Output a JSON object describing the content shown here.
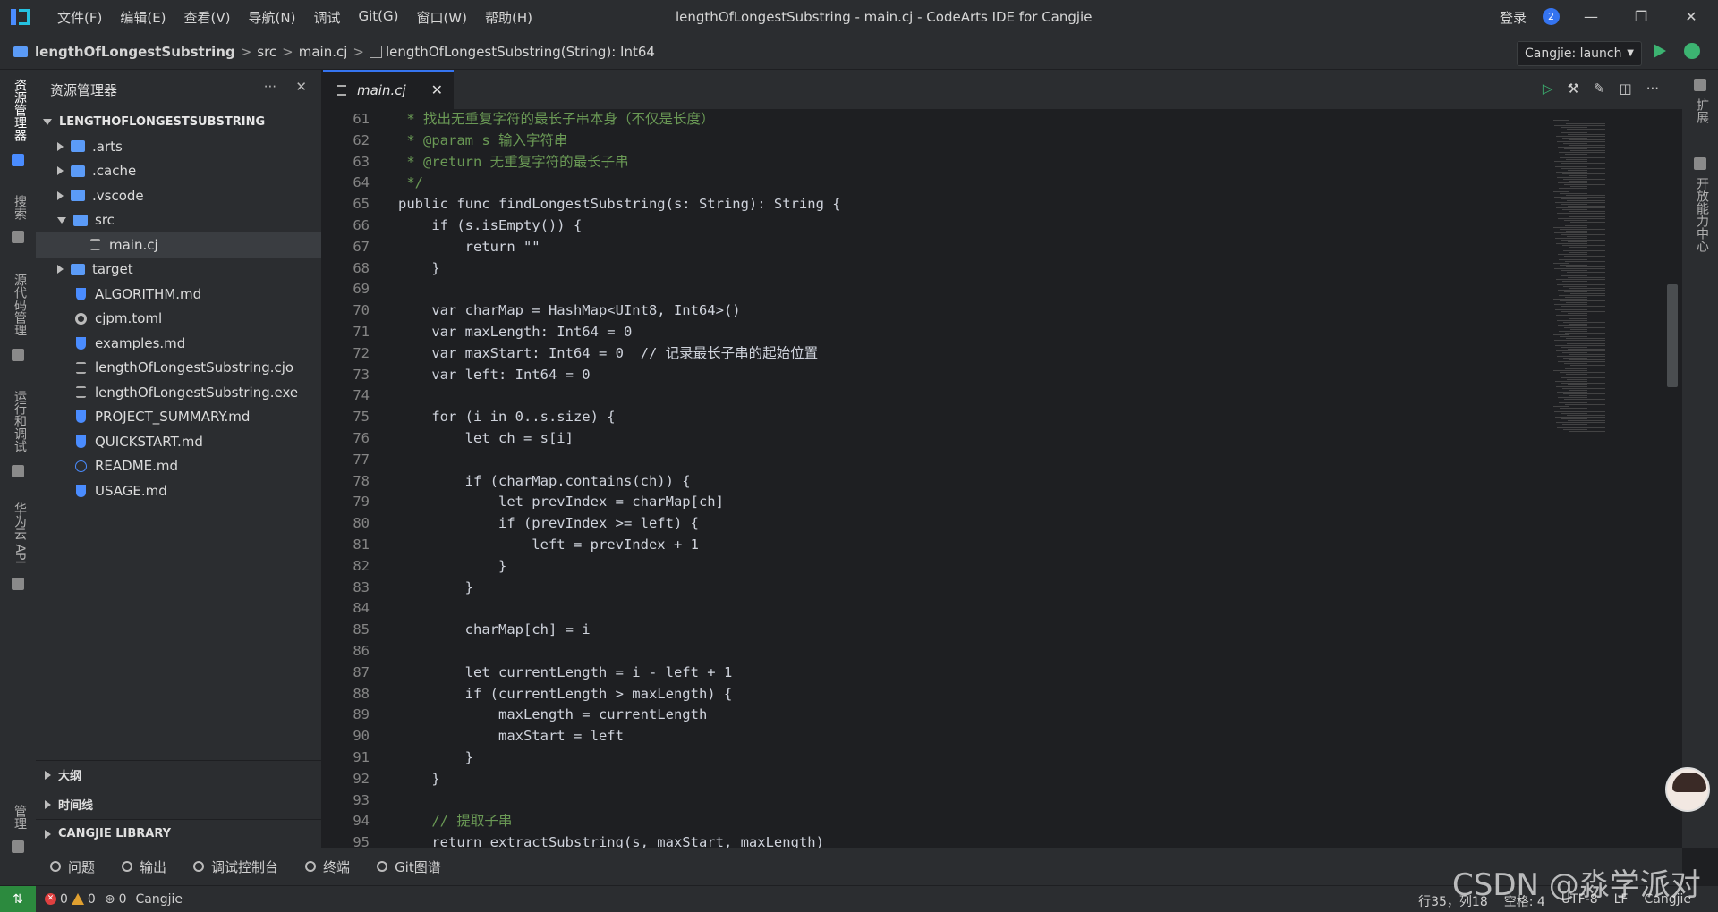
{
  "titlebar": {
    "menus": [
      "文件(F)",
      "编辑(E)",
      "查看(V)",
      "导航(N)",
      "调试",
      "Git(G)",
      "窗口(W)",
      "帮助(H)"
    ],
    "window_title": "lengthOfLongestSubstring - main.cj - CodeArts IDE for Cangjie",
    "login": "登录",
    "notification_count": "2"
  },
  "breadcrumb": {
    "project": "lengthOfLongestSubstring",
    "folder": "src",
    "file": "main.cj",
    "symbol": "lengthOfLongestSubstring(String): Int64",
    "sep": ">"
  },
  "run_config": "Cangjie: launch",
  "activity_left": [
    "资源管理器",
    "搜索",
    "源代码管理",
    "运行和调试",
    "华为云 API",
    "管理"
  ],
  "activity_right": [
    "扩展",
    "开放能力中心"
  ],
  "explorer": {
    "title": "资源管理器",
    "root": "LENGTHOFLONGESTSUBSTRING",
    "items": [
      {
        "label": ".arts",
        "kind": "folder"
      },
      {
        "label": ".cache",
        "kind": "folder"
      },
      {
        "label": ".vscode",
        "kind": "folder"
      },
      {
        "label": "src",
        "kind": "folder"
      },
      {
        "label": "main.cj",
        "kind": "file"
      },
      {
        "label": "target",
        "kind": "folder"
      },
      {
        "label": "ALGORITHM.md",
        "kind": "md"
      },
      {
        "label": "cjpm.toml",
        "kind": "gear"
      },
      {
        "label": "examples.md",
        "kind": "md"
      },
      {
        "label": "lengthOfLongestSubstring.cjo",
        "kind": "file"
      },
      {
        "label": "lengthOfLongestSubstring.exe",
        "kind": "file"
      },
      {
        "label": "PROJECT_SUMMARY.md",
        "kind": "md"
      },
      {
        "label": "QUICKSTART.md",
        "kind": "md"
      },
      {
        "label": "README.md",
        "kind": "info"
      },
      {
        "label": "USAGE.md",
        "kind": "md"
      }
    ],
    "sections": [
      "大纲",
      "时间线",
      "CANGJIE LIBRARY"
    ]
  },
  "editor": {
    "tab": "main.cj",
    "lines": [
      {
        "n": "61",
        "t": " * 找出无重复字符的最长子串本身（不仅是长度）"
      },
      {
        "n": "62",
        "t": " * @param s 输入字符串"
      },
      {
        "n": "63",
        "t": " * @return 无重复字符的最长子串"
      },
      {
        "n": "64",
        "t": " */"
      },
      {
        "n": "65",
        "t": "public func findLongestSubstring(s: String): String {"
      },
      {
        "n": "66",
        "t": "    if (s.isEmpty()) {"
      },
      {
        "n": "67",
        "t": "        return \"\""
      },
      {
        "n": "68",
        "t": "    }"
      },
      {
        "n": "69",
        "t": ""
      },
      {
        "n": "70",
        "t": "    var charMap = HashMap<UInt8, Int64>()"
      },
      {
        "n": "71",
        "t": "    var maxLength: Int64 = 0"
      },
      {
        "n": "72",
        "t": "    var maxStart: Int64 = 0  // 记录最长子串的起始位置"
      },
      {
        "n": "73",
        "t": "    var left: Int64 = 0"
      },
      {
        "n": "74",
        "t": ""
      },
      {
        "n": "75",
        "t": "    for (i in 0..s.size) {"
      },
      {
        "n": "76",
        "t": "        let ch = s[i]"
      },
      {
        "n": "77",
        "t": ""
      },
      {
        "n": "78",
        "t": "        if (charMap.contains(ch)) {"
      },
      {
        "n": "79",
        "t": "            let prevIndex = charMap[ch]"
      },
      {
        "n": "80",
        "t": "            if (prevIndex >= left) {"
      },
      {
        "n": "81",
        "t": "                left = prevIndex + 1"
      },
      {
        "n": "82",
        "t": "            }"
      },
      {
        "n": "83",
        "t": "        }"
      },
      {
        "n": "84",
        "t": ""
      },
      {
        "n": "85",
        "t": "        charMap[ch] = i"
      },
      {
        "n": "86",
        "t": ""
      },
      {
        "n": "87",
        "t": "        let currentLength = i - left + 1"
      },
      {
        "n": "88",
        "t": "        if (currentLength > maxLength) {"
      },
      {
        "n": "89",
        "t": "            maxLength = currentLength"
      },
      {
        "n": "90",
        "t": "            maxStart = left"
      },
      {
        "n": "91",
        "t": "        }"
      },
      {
        "n": "92",
        "t": "    }"
      },
      {
        "n": "93",
        "t": ""
      },
      {
        "n": "94",
        "t": "    // 提取子串"
      },
      {
        "n": "95",
        "t": "    return extractSubstring(s, maxStart, maxLength)"
      }
    ]
  },
  "panel_tabs": [
    "问题",
    "输出",
    "调试控制台",
    "终端",
    "Git图谱"
  ],
  "status": {
    "errors": "0",
    "warnings": "0",
    "ports": "0",
    "language_left": "Cangjie",
    "position": "行35，列18",
    "indent": "空格: 4",
    "encoding": "UTF-8",
    "eol": "LF",
    "language": "Cangjie"
  },
  "watermark": "CSDN @淼学派对",
  "colors": {
    "accent": "#3574f0",
    "run": "#3cb371",
    "comment": "#6a9955",
    "keyword": "#c586c0",
    "type": "#4ec9b0"
  }
}
